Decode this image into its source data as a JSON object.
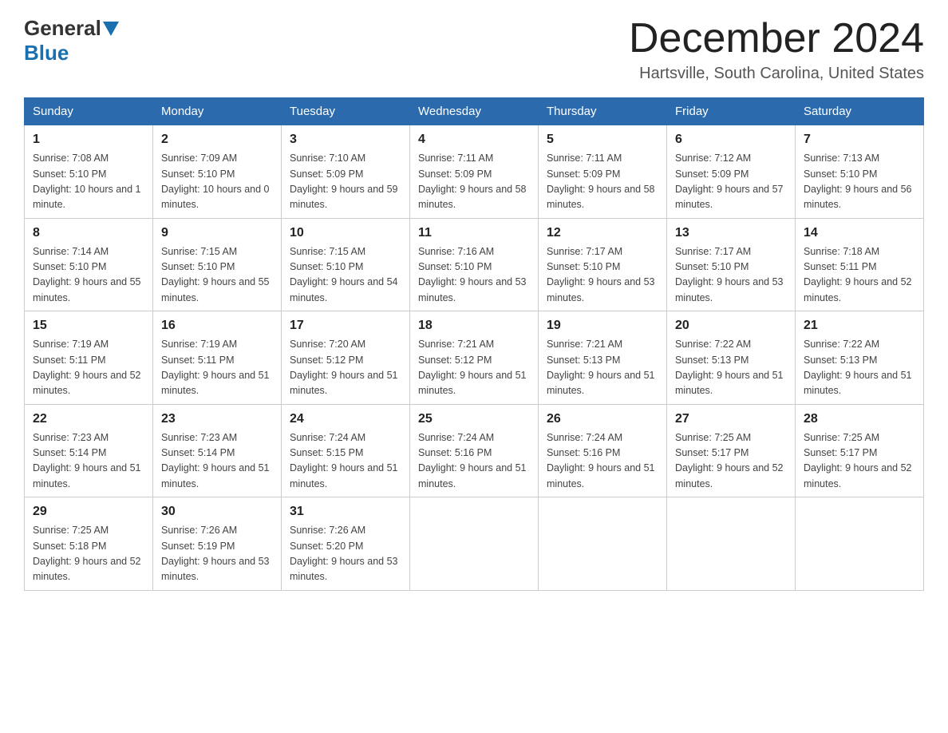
{
  "header": {
    "logo_general": "General",
    "logo_blue": "Blue",
    "month_title": "December 2024",
    "location": "Hartsville, South Carolina, United States"
  },
  "weekdays": [
    "Sunday",
    "Monday",
    "Tuesday",
    "Wednesday",
    "Thursday",
    "Friday",
    "Saturday"
  ],
  "weeks": [
    [
      {
        "day": "1",
        "sunrise": "7:08 AM",
        "sunset": "5:10 PM",
        "daylight": "10 hours and 1 minute."
      },
      {
        "day": "2",
        "sunrise": "7:09 AM",
        "sunset": "5:10 PM",
        "daylight": "10 hours and 0 minutes."
      },
      {
        "day": "3",
        "sunrise": "7:10 AM",
        "sunset": "5:09 PM",
        "daylight": "9 hours and 59 minutes."
      },
      {
        "day": "4",
        "sunrise": "7:11 AM",
        "sunset": "5:09 PM",
        "daylight": "9 hours and 58 minutes."
      },
      {
        "day": "5",
        "sunrise": "7:11 AM",
        "sunset": "5:09 PM",
        "daylight": "9 hours and 58 minutes."
      },
      {
        "day": "6",
        "sunrise": "7:12 AM",
        "sunset": "5:09 PM",
        "daylight": "9 hours and 57 minutes."
      },
      {
        "day": "7",
        "sunrise": "7:13 AM",
        "sunset": "5:10 PM",
        "daylight": "9 hours and 56 minutes."
      }
    ],
    [
      {
        "day": "8",
        "sunrise": "7:14 AM",
        "sunset": "5:10 PM",
        "daylight": "9 hours and 55 minutes."
      },
      {
        "day": "9",
        "sunrise": "7:15 AM",
        "sunset": "5:10 PM",
        "daylight": "9 hours and 55 minutes."
      },
      {
        "day": "10",
        "sunrise": "7:15 AM",
        "sunset": "5:10 PM",
        "daylight": "9 hours and 54 minutes."
      },
      {
        "day": "11",
        "sunrise": "7:16 AM",
        "sunset": "5:10 PM",
        "daylight": "9 hours and 53 minutes."
      },
      {
        "day": "12",
        "sunrise": "7:17 AM",
        "sunset": "5:10 PM",
        "daylight": "9 hours and 53 minutes."
      },
      {
        "day": "13",
        "sunrise": "7:17 AM",
        "sunset": "5:10 PM",
        "daylight": "9 hours and 53 minutes."
      },
      {
        "day": "14",
        "sunrise": "7:18 AM",
        "sunset": "5:11 PM",
        "daylight": "9 hours and 52 minutes."
      }
    ],
    [
      {
        "day": "15",
        "sunrise": "7:19 AM",
        "sunset": "5:11 PM",
        "daylight": "9 hours and 52 minutes."
      },
      {
        "day": "16",
        "sunrise": "7:19 AM",
        "sunset": "5:11 PM",
        "daylight": "9 hours and 51 minutes."
      },
      {
        "day": "17",
        "sunrise": "7:20 AM",
        "sunset": "5:12 PM",
        "daylight": "9 hours and 51 minutes."
      },
      {
        "day": "18",
        "sunrise": "7:21 AM",
        "sunset": "5:12 PM",
        "daylight": "9 hours and 51 minutes."
      },
      {
        "day": "19",
        "sunrise": "7:21 AM",
        "sunset": "5:13 PM",
        "daylight": "9 hours and 51 minutes."
      },
      {
        "day": "20",
        "sunrise": "7:22 AM",
        "sunset": "5:13 PM",
        "daylight": "9 hours and 51 minutes."
      },
      {
        "day": "21",
        "sunrise": "7:22 AM",
        "sunset": "5:13 PM",
        "daylight": "9 hours and 51 minutes."
      }
    ],
    [
      {
        "day": "22",
        "sunrise": "7:23 AM",
        "sunset": "5:14 PM",
        "daylight": "9 hours and 51 minutes."
      },
      {
        "day": "23",
        "sunrise": "7:23 AM",
        "sunset": "5:14 PM",
        "daylight": "9 hours and 51 minutes."
      },
      {
        "day": "24",
        "sunrise": "7:24 AM",
        "sunset": "5:15 PM",
        "daylight": "9 hours and 51 minutes."
      },
      {
        "day": "25",
        "sunrise": "7:24 AM",
        "sunset": "5:16 PM",
        "daylight": "9 hours and 51 minutes."
      },
      {
        "day": "26",
        "sunrise": "7:24 AM",
        "sunset": "5:16 PM",
        "daylight": "9 hours and 51 minutes."
      },
      {
        "day": "27",
        "sunrise": "7:25 AM",
        "sunset": "5:17 PM",
        "daylight": "9 hours and 52 minutes."
      },
      {
        "day": "28",
        "sunrise": "7:25 AM",
        "sunset": "5:17 PM",
        "daylight": "9 hours and 52 minutes."
      }
    ],
    [
      {
        "day": "29",
        "sunrise": "7:25 AM",
        "sunset": "5:18 PM",
        "daylight": "9 hours and 52 minutes."
      },
      {
        "day": "30",
        "sunrise": "7:26 AM",
        "sunset": "5:19 PM",
        "daylight": "9 hours and 53 minutes."
      },
      {
        "day": "31",
        "sunrise": "7:26 AM",
        "sunset": "5:20 PM",
        "daylight": "9 hours and 53 minutes."
      },
      null,
      null,
      null,
      null
    ]
  ]
}
